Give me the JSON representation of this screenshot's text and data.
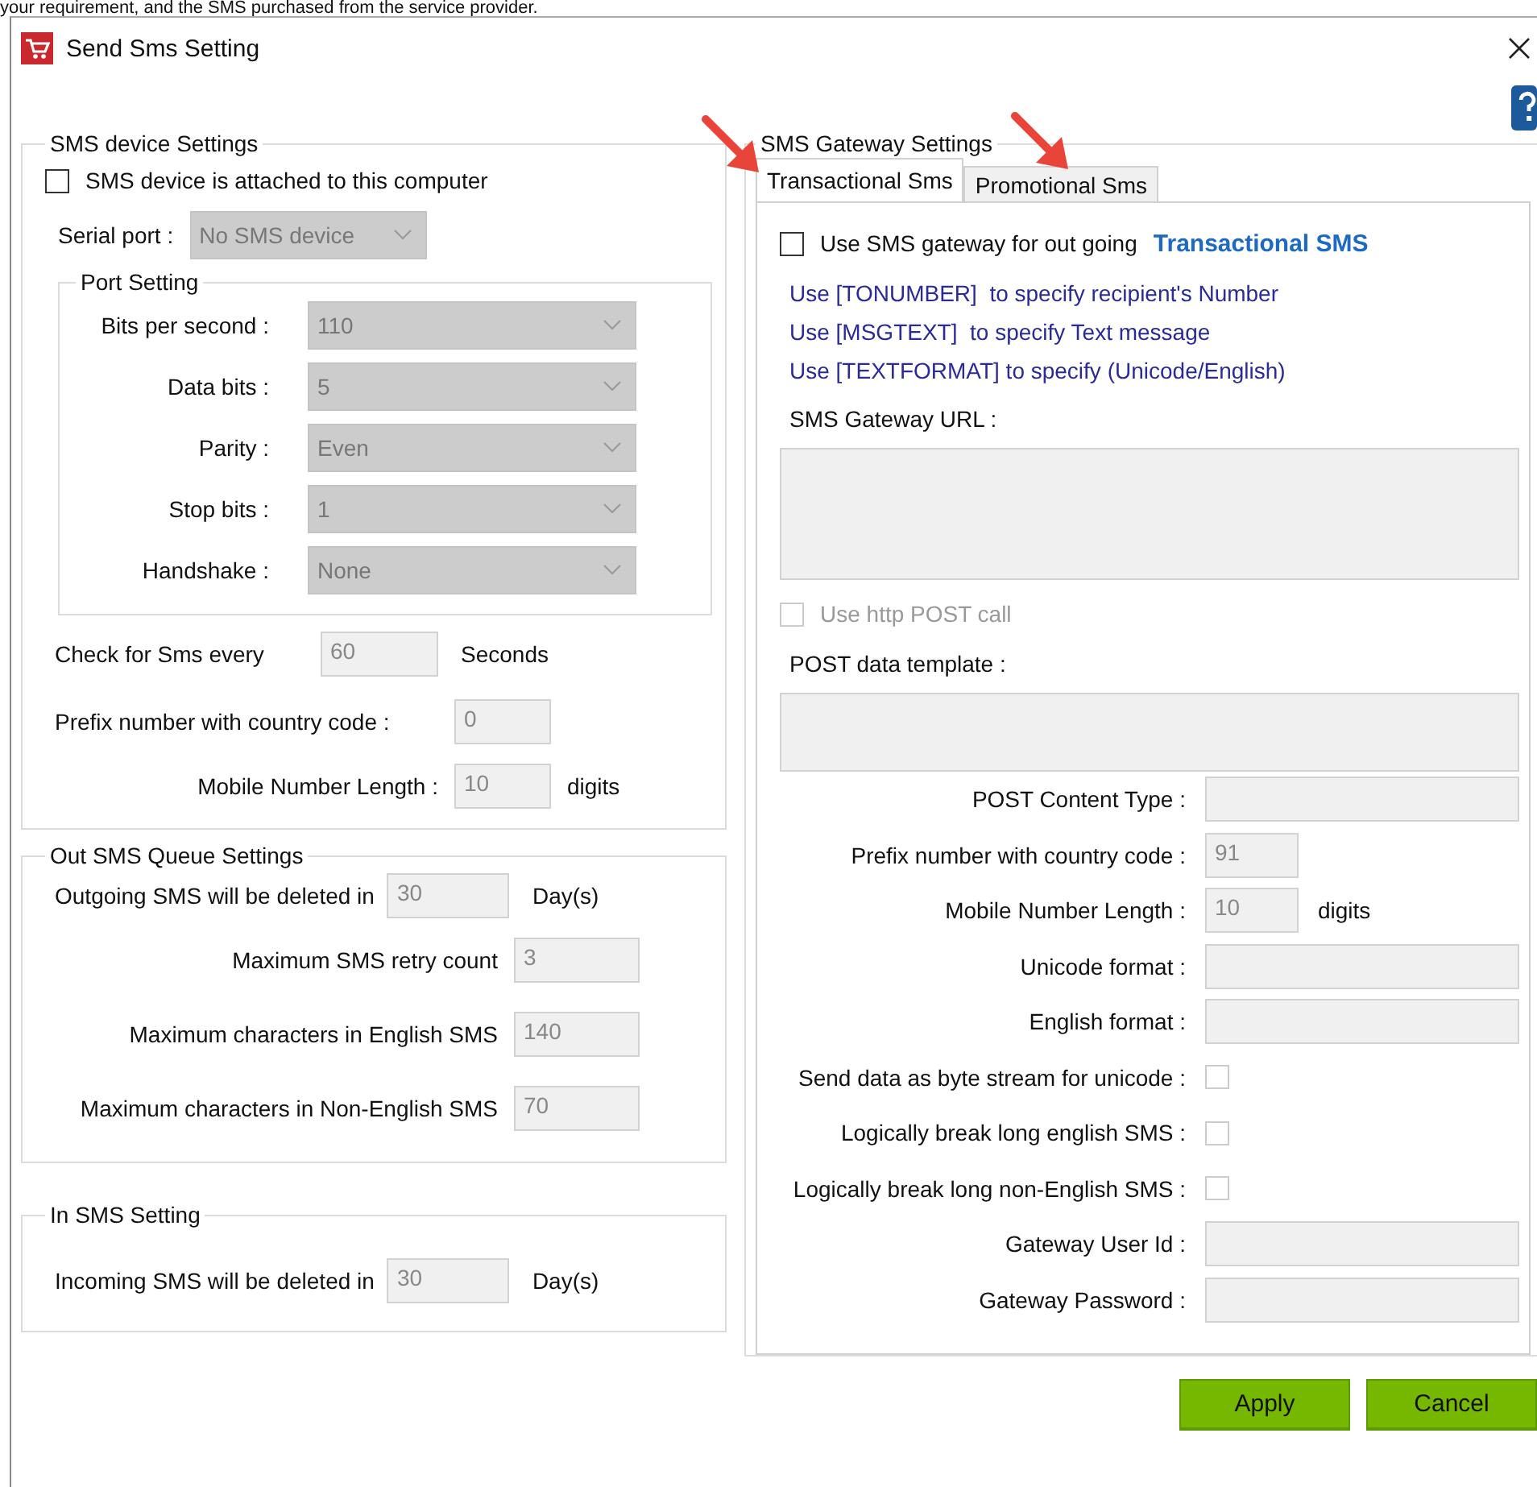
{
  "caption_fragment": "your requirement, and the SMS purchased from the service provider.",
  "window": {
    "title": "Send Sms Setting"
  },
  "device_settings": {
    "title": "SMS device Settings",
    "attached": {
      "label": "SMS device is attached to this computer",
      "checked": false
    },
    "serial_port": {
      "label": "Serial port :",
      "value": "No SMS device"
    },
    "port_setting": {
      "title": "Port Setting",
      "fields": [
        {
          "label": "Bits per second :",
          "value": "110"
        },
        {
          "label": "Data bits :",
          "value": "5"
        },
        {
          "label": "Parity :",
          "value": "Even"
        },
        {
          "label": "Stop bits :",
          "value": "1"
        },
        {
          "label": "Handshake :",
          "value": "None"
        }
      ]
    },
    "check_every": {
      "label": "Check for Sms every",
      "value": "60",
      "unit": "Seconds"
    },
    "prefix": {
      "label": "Prefix number with country code :",
      "value": "0"
    },
    "mobile_length": {
      "label": "Mobile Number Length :",
      "value": "10",
      "unit": "digits"
    }
  },
  "out_queue": {
    "title": "Out SMS Queue Settings",
    "fields": [
      {
        "kind": "inline",
        "label": "Outgoing SMS will be deleted in",
        "value": "30",
        "unit": "Day(s)"
      },
      {
        "kind": "aligned",
        "label": "Maximum SMS retry count",
        "value": "3"
      },
      {
        "kind": "aligned",
        "label": "Maximum characters in English SMS",
        "value": "140"
      },
      {
        "kind": "aligned",
        "label": "Maximum characters in Non-English SMS",
        "value": "70"
      }
    ]
  },
  "in_setting": {
    "title": "In SMS Setting",
    "fields": [
      {
        "kind": "inline",
        "label": "Incoming SMS will be deleted in",
        "value": "30",
        "unit": "Day(s)"
      }
    ]
  },
  "gateway": {
    "title": "SMS Gateway Settings",
    "tabs": [
      {
        "label": "Transactional Sms",
        "selected": true
      },
      {
        "label": "Promotional Sms",
        "selected": false
      }
    ],
    "use_gateway": {
      "label": "Use SMS gateway for out going",
      "highlight": "Transactional SMS",
      "checked": false
    },
    "hints": [
      "Use [TONUMBER]  to specify recipient's Number",
      "Use [MSGTEXT]  to specify Text message",
      "Use [TEXTFORMAT] to specify (Unicode/English)"
    ],
    "url": {
      "label": "SMS Gateway URL :"
    },
    "http_post": {
      "label": "Use http POST call",
      "checked": false,
      "disabled": true
    },
    "post_template": {
      "label": "POST data template :"
    },
    "fields": [
      {
        "kind": "text",
        "label": "POST Content Type :"
      },
      {
        "kind": "short",
        "label": "Prefix number with country code :",
        "value": "91"
      },
      {
        "kind": "short",
        "label": "Mobile Number Length :",
        "value": "10",
        "unit": "digits"
      },
      {
        "kind": "text",
        "label": "Unicode format :"
      },
      {
        "kind": "text",
        "label": "English format :"
      },
      {
        "kind": "checkbox",
        "label": "Send data as byte stream for unicode :",
        "checked": false
      },
      {
        "kind": "checkbox",
        "label": "Logically break long english SMS :",
        "checked": false
      },
      {
        "kind": "checkbox",
        "label": "Logically break long non-English SMS :",
        "checked": false
      },
      {
        "kind": "text",
        "label": "Gateway User Id :"
      },
      {
        "kind": "text",
        "label": "Gateway Password :"
      }
    ]
  },
  "buttons": [
    {
      "label": "Apply"
    },
    {
      "label": "Cancel"
    }
  ]
}
